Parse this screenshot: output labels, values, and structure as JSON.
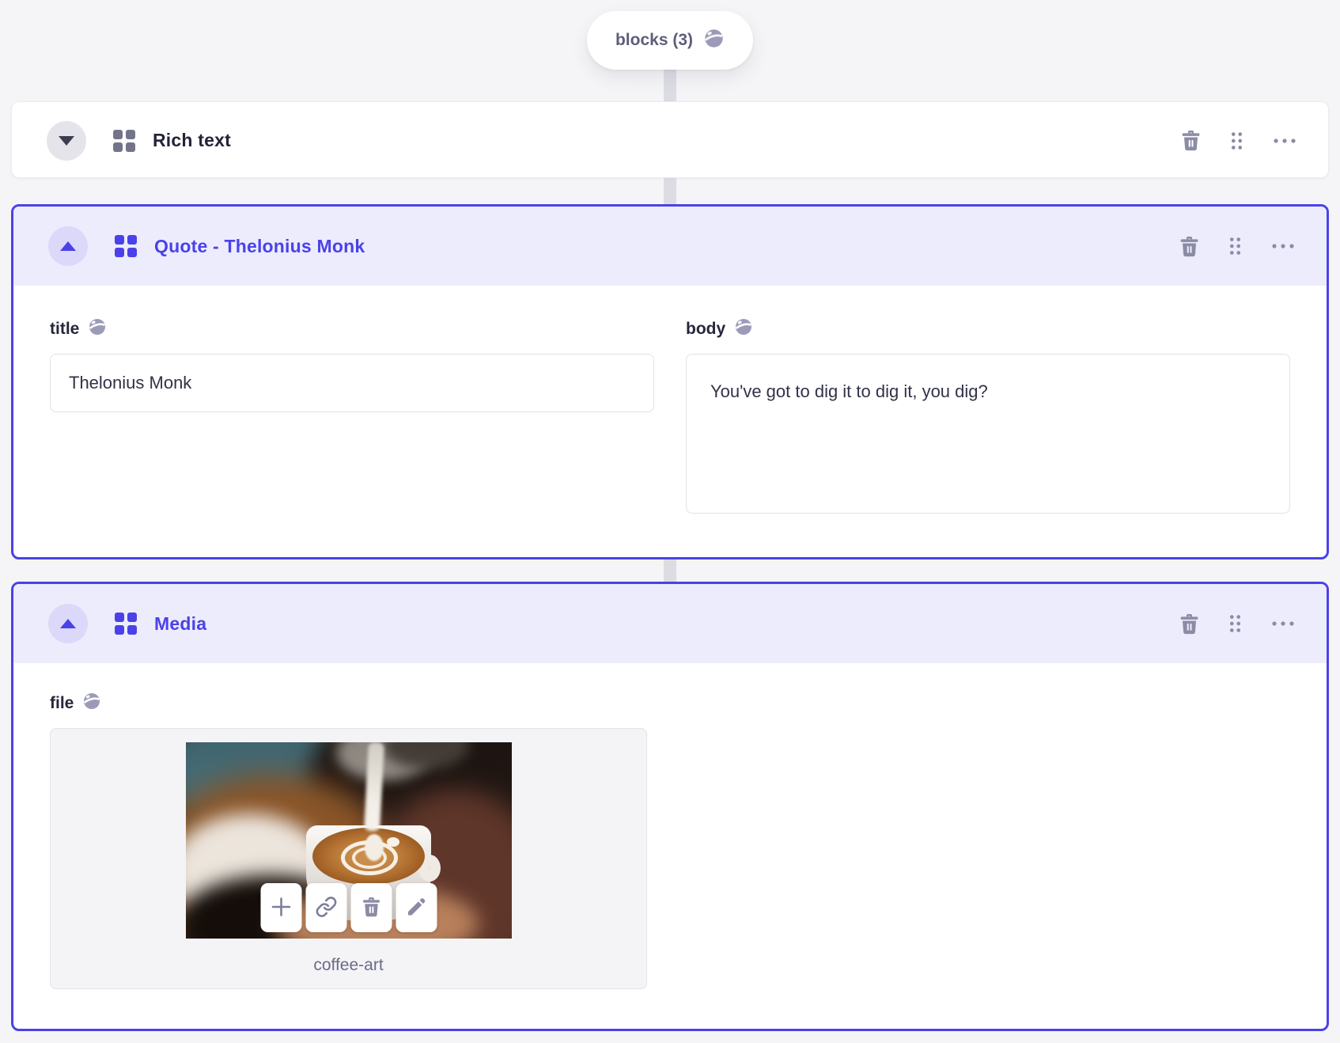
{
  "colors": {
    "accent": "#4a42e8",
    "accent_header_bg": "#edecfd",
    "page_bg": "#f5f5f7",
    "icon_slate": "#8b8ba6",
    "text_dark": "#26263c",
    "pill_text": "#5d5d7c",
    "caption_text": "#6a6a88"
  },
  "pill": {
    "label": "blocks (3)",
    "icon": "globe-icon"
  },
  "block_actions": {
    "delete": "delete-block",
    "drag": "drag-handle",
    "more": "more-options"
  },
  "blocks": [
    {
      "title": "Rich text",
      "state": "collapsed",
      "selected": false
    },
    {
      "title": "Quote - Thelonius Monk",
      "state": "expanded",
      "selected": true,
      "fields": [
        {
          "label": "title",
          "type": "text-input",
          "value": "Thelonius Monk",
          "icon": "globe-icon"
        },
        {
          "label": "body",
          "type": "textarea",
          "value": "You've got to dig it to dig it, you dig?",
          "icon": "globe-icon"
        }
      ]
    },
    {
      "title": "Media",
      "state": "expanded",
      "selected": true,
      "fields": [
        {
          "label": "file",
          "type": "image",
          "caption": "coffee-art",
          "icon": "globe-icon",
          "image_actions": [
            "add",
            "link",
            "delete",
            "edit"
          ]
        }
      ]
    }
  ]
}
